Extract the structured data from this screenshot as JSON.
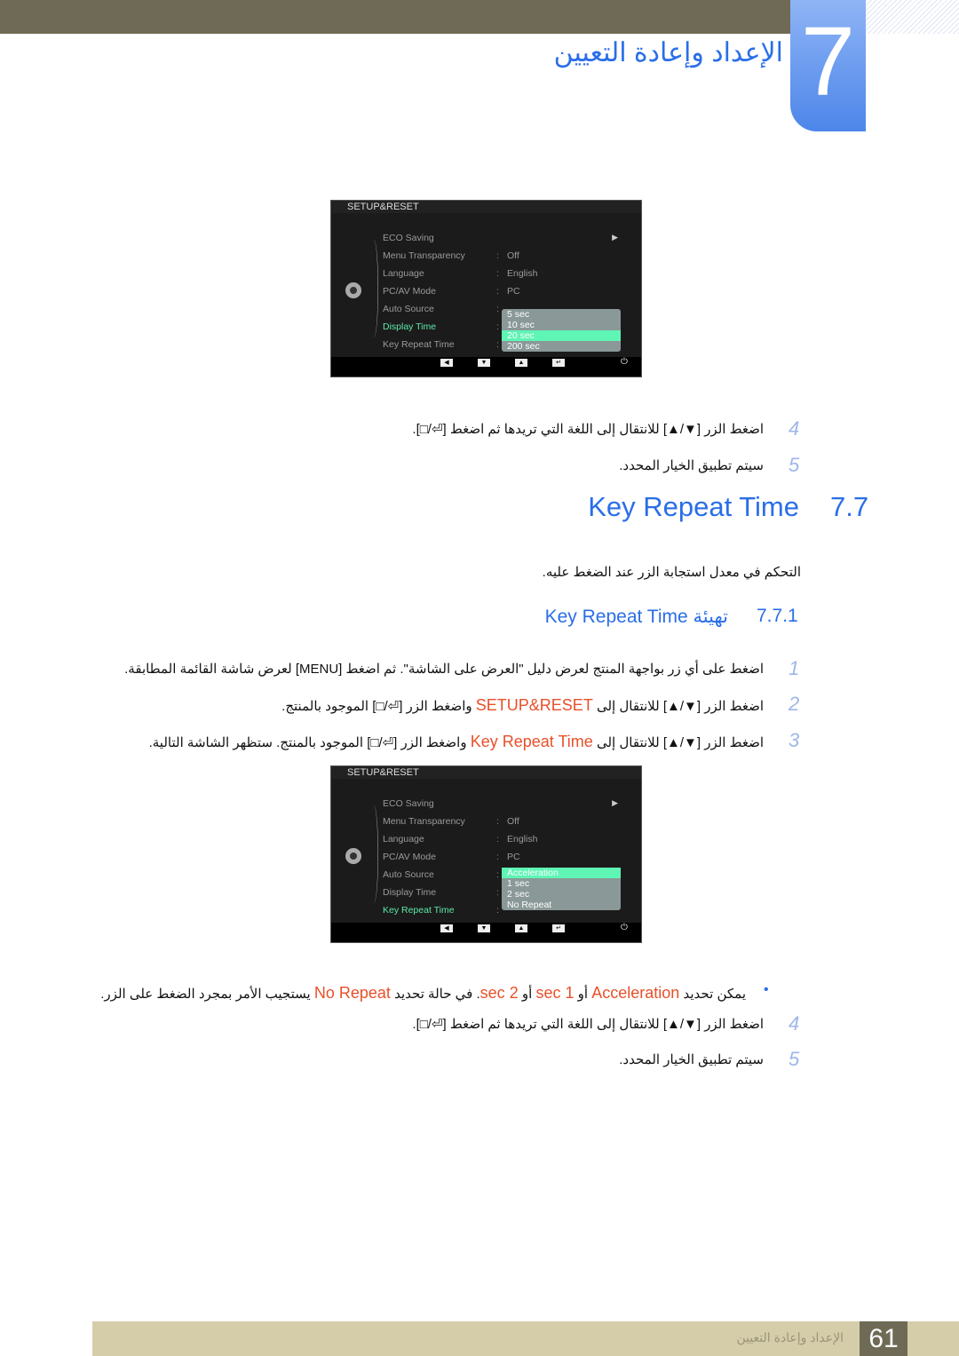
{
  "header": {
    "chapter_number": "7",
    "title": "الإعداد وإعادة التعيين"
  },
  "osd1": {
    "title": "SETUP&RESET",
    "items": [
      {
        "label": "ECO Saving",
        "value": ""
      },
      {
        "label": "Menu Transparency",
        "value": "Off"
      },
      {
        "label": "Language",
        "value": "English"
      },
      {
        "label": "PC/AV Mode",
        "value": "PC"
      },
      {
        "label": "Auto Source",
        "value": ""
      },
      {
        "label": "Display Time",
        "value": ""
      },
      {
        "label": "Key Repeat Time",
        "value": ""
      }
    ],
    "dropdown": [
      "5 sec",
      "10 sec",
      "20 sec",
      "200 sec"
    ],
    "selected": "20 sec",
    "highlighted_item": "Display Time"
  },
  "steps_a": [
    {
      "n": "4",
      "text": "اضغط الزر [▼/▲] للانتقال إلى اللغة التي تريدها ثم اضغط [⏎/□]."
    },
    {
      "n": "5",
      "text": "سيتم تطبيق الخيار المحدد."
    }
  ],
  "section": {
    "number": "7.7",
    "title": "Key Repeat Time",
    "description": "التحكم في معدل استجابة الزر عند الضغط عليه."
  },
  "subsection": {
    "number": "7.7.1",
    "title": "تهيئة Key Repeat Time"
  },
  "steps_b": [
    {
      "n": "1",
      "text": "اضغط على أي زر بواجهة المنتج لعرض دليل \"العرض على الشاشة\". ثم اضغط [MENU] لعرض شاشة القائمة المطابقة."
    },
    {
      "n": "2",
      "pre": "اضغط الزر [▼/▲] للانتقال إلى ",
      "hl": "SETUP&RESET",
      "post": " واضغط الزر [⏎/□] الموجود بالمنتج."
    },
    {
      "n": "3",
      "pre": "اضغط الزر [▼/▲] للانتقال إلى ",
      "hl": "Key Repeat Time",
      "post": " واضغط الزر [⏎/□] الموجود بالمنتج. ستظهر الشاشة التالية."
    }
  ],
  "osd2": {
    "title": "SETUP&RESET",
    "dropdown": [
      "Acceleration",
      "1 sec",
      "2 sec",
      "No Repeat"
    ],
    "selected": "Acceleration",
    "highlighted_item": "Key Repeat Time"
  },
  "note": {
    "p1": "يمكن تحديد ",
    "h1": "Acceleration",
    "p2": " أو ",
    "h2": "1 sec",
    "p3": " أو ",
    "h3": "2 sec",
    "p4": ". في حالة تحديد ",
    "h4": "No Repeat",
    "p5": " يستجيب الأمر بمجرد الضغط على الزر."
  },
  "steps_c": [
    {
      "n": "4",
      "text": "اضغط الزر [▼/▲] للانتقال إلى اللغة التي تريدها ثم اضغط [⏎/□]."
    },
    {
      "n": "5",
      "text": "سيتم تطبيق الخيار المحدد."
    }
  ],
  "footer": {
    "title": "الإعداد وإعادة التعيين",
    "page": "61"
  },
  "colors": {
    "accent": "#2a6ee8",
    "highlight": "#e8502a",
    "osd_select": "#5ef5b5"
  }
}
